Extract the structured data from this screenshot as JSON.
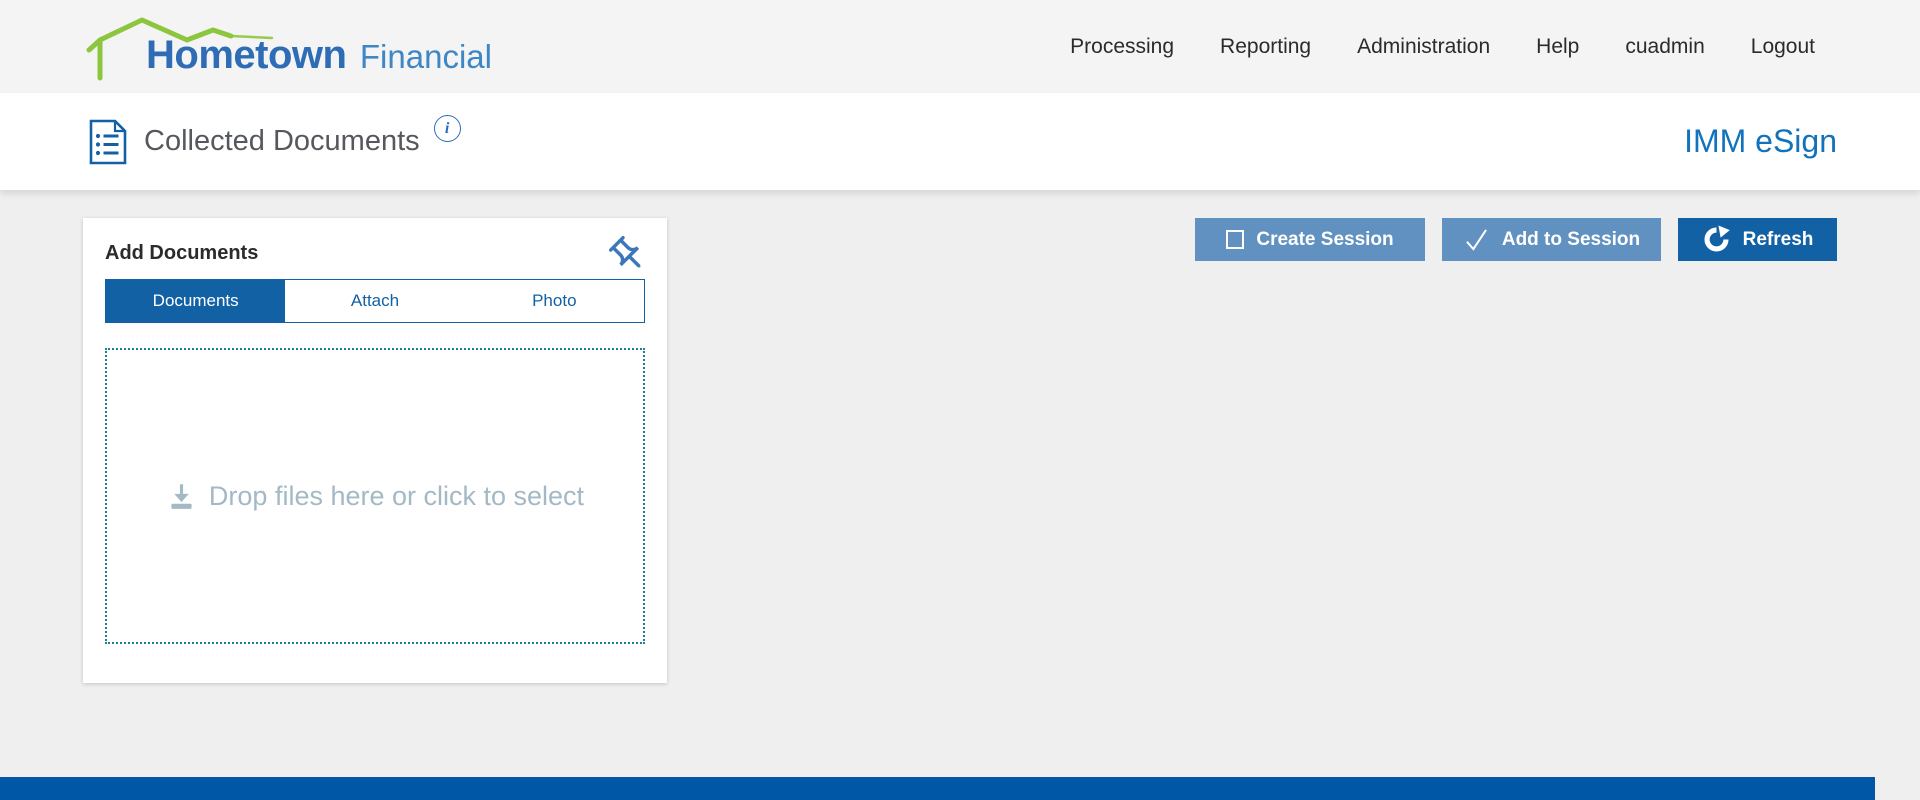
{
  "brand": {
    "name_primary": "Hometown",
    "name_secondary": "Financial"
  },
  "nav": {
    "items": [
      "Processing",
      "Reporting",
      "Administration",
      "Help",
      "cuadmin",
      "Logout"
    ]
  },
  "header": {
    "title": "Collected Documents",
    "info_symbol": "i",
    "product": "IMM eSign"
  },
  "panel": {
    "title": "Add Documents",
    "tabs": [
      "Documents",
      "Attach",
      "Photo"
    ],
    "active_tab": "Documents",
    "dropzone_text": "Drop files here or click to select"
  },
  "actions": {
    "create_session": "Create Session",
    "add_to_session": "Add to Session",
    "refresh": "Refresh"
  },
  "colors": {
    "accent_blue": "#1261a5",
    "button_blue": "#6191c1",
    "footer_blue": "#0057a5",
    "teal_border": "#1b7f9b",
    "brand_green": "#8cc63e",
    "brand_blue": "#2e6db6",
    "brand_blue_light": "#3e87c6",
    "product_blue": "#1273bd",
    "muted_blue_grey": "#a3b9c5",
    "icon_blue": "#2a6eb8"
  }
}
